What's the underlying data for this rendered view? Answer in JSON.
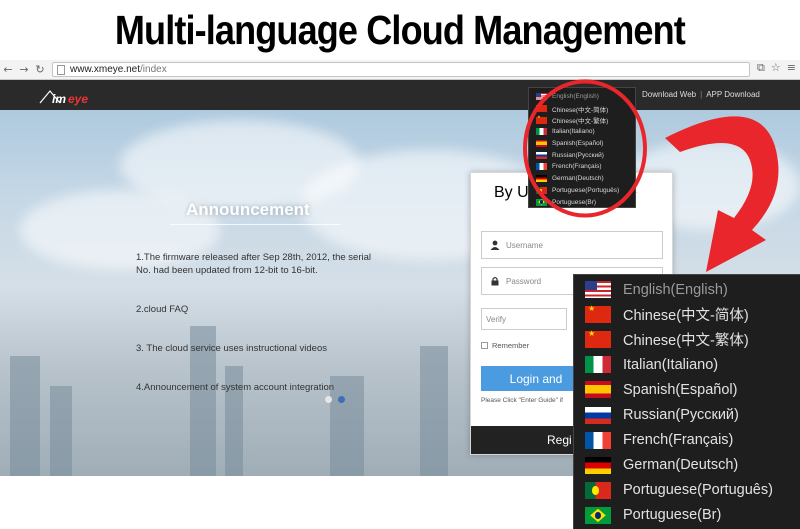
{
  "banner": {
    "title": "Multi-language Cloud Management"
  },
  "browser": {
    "back_icon": "back-arrow-icon",
    "forward_icon": "forward-arrow-icon",
    "reload_icon": "reload-icon",
    "url_host": "www.xmeye.net",
    "url_path": "/index"
  },
  "site": {
    "logo_text": "xmeye",
    "top_links": {
      "download_web": "Download Web",
      "separator": "|",
      "app_download": "APP Download"
    },
    "announcement": {
      "title": "Announcement",
      "items": [
        "1.The firmware released after Sep 28th, 2012, the serial No. had been updated from 12-bit to 16-bit.",
        "2.cloud FAQ",
        "3. The cloud service uses instructional videos",
        "4.Announcement of system account integration"
      ]
    },
    "login": {
      "tab_left": "By Us",
      "tab_right": "e",
      "username_placeholder": "Username",
      "password_placeholder": "Password",
      "verify_placeholder": "Verify",
      "remember_label": "Remember",
      "login_button": "Login and",
      "hint": "Please Click \"Enter Guide\" if",
      "register": "Regi"
    }
  },
  "languages": [
    {
      "label": "English(English)",
      "flag": "us"
    },
    {
      "label": "Chinese(中文-简体)",
      "flag": "cn"
    },
    {
      "label": "Chinese(中文-繁体)",
      "flag": "cn"
    },
    {
      "label": "Italian(Italiano)",
      "flag": "it"
    },
    {
      "label": "Spanish(Español)",
      "flag": "es"
    },
    {
      "label": "Russian(Русский)",
      "flag": "ru"
    },
    {
      "label": "French(Français)",
      "flag": "fr"
    },
    {
      "label": "German(Deutsch)",
      "flag": "de"
    },
    {
      "label": "Portuguese(Português)",
      "flag": "pt"
    },
    {
      "label": "Portuguese(Br)",
      "flag": "br"
    }
  ],
  "colors": {
    "annotation_red": "#e8262c",
    "login_blue": "#4a9be0",
    "dropdown_bg": "#1e1e1e"
  }
}
